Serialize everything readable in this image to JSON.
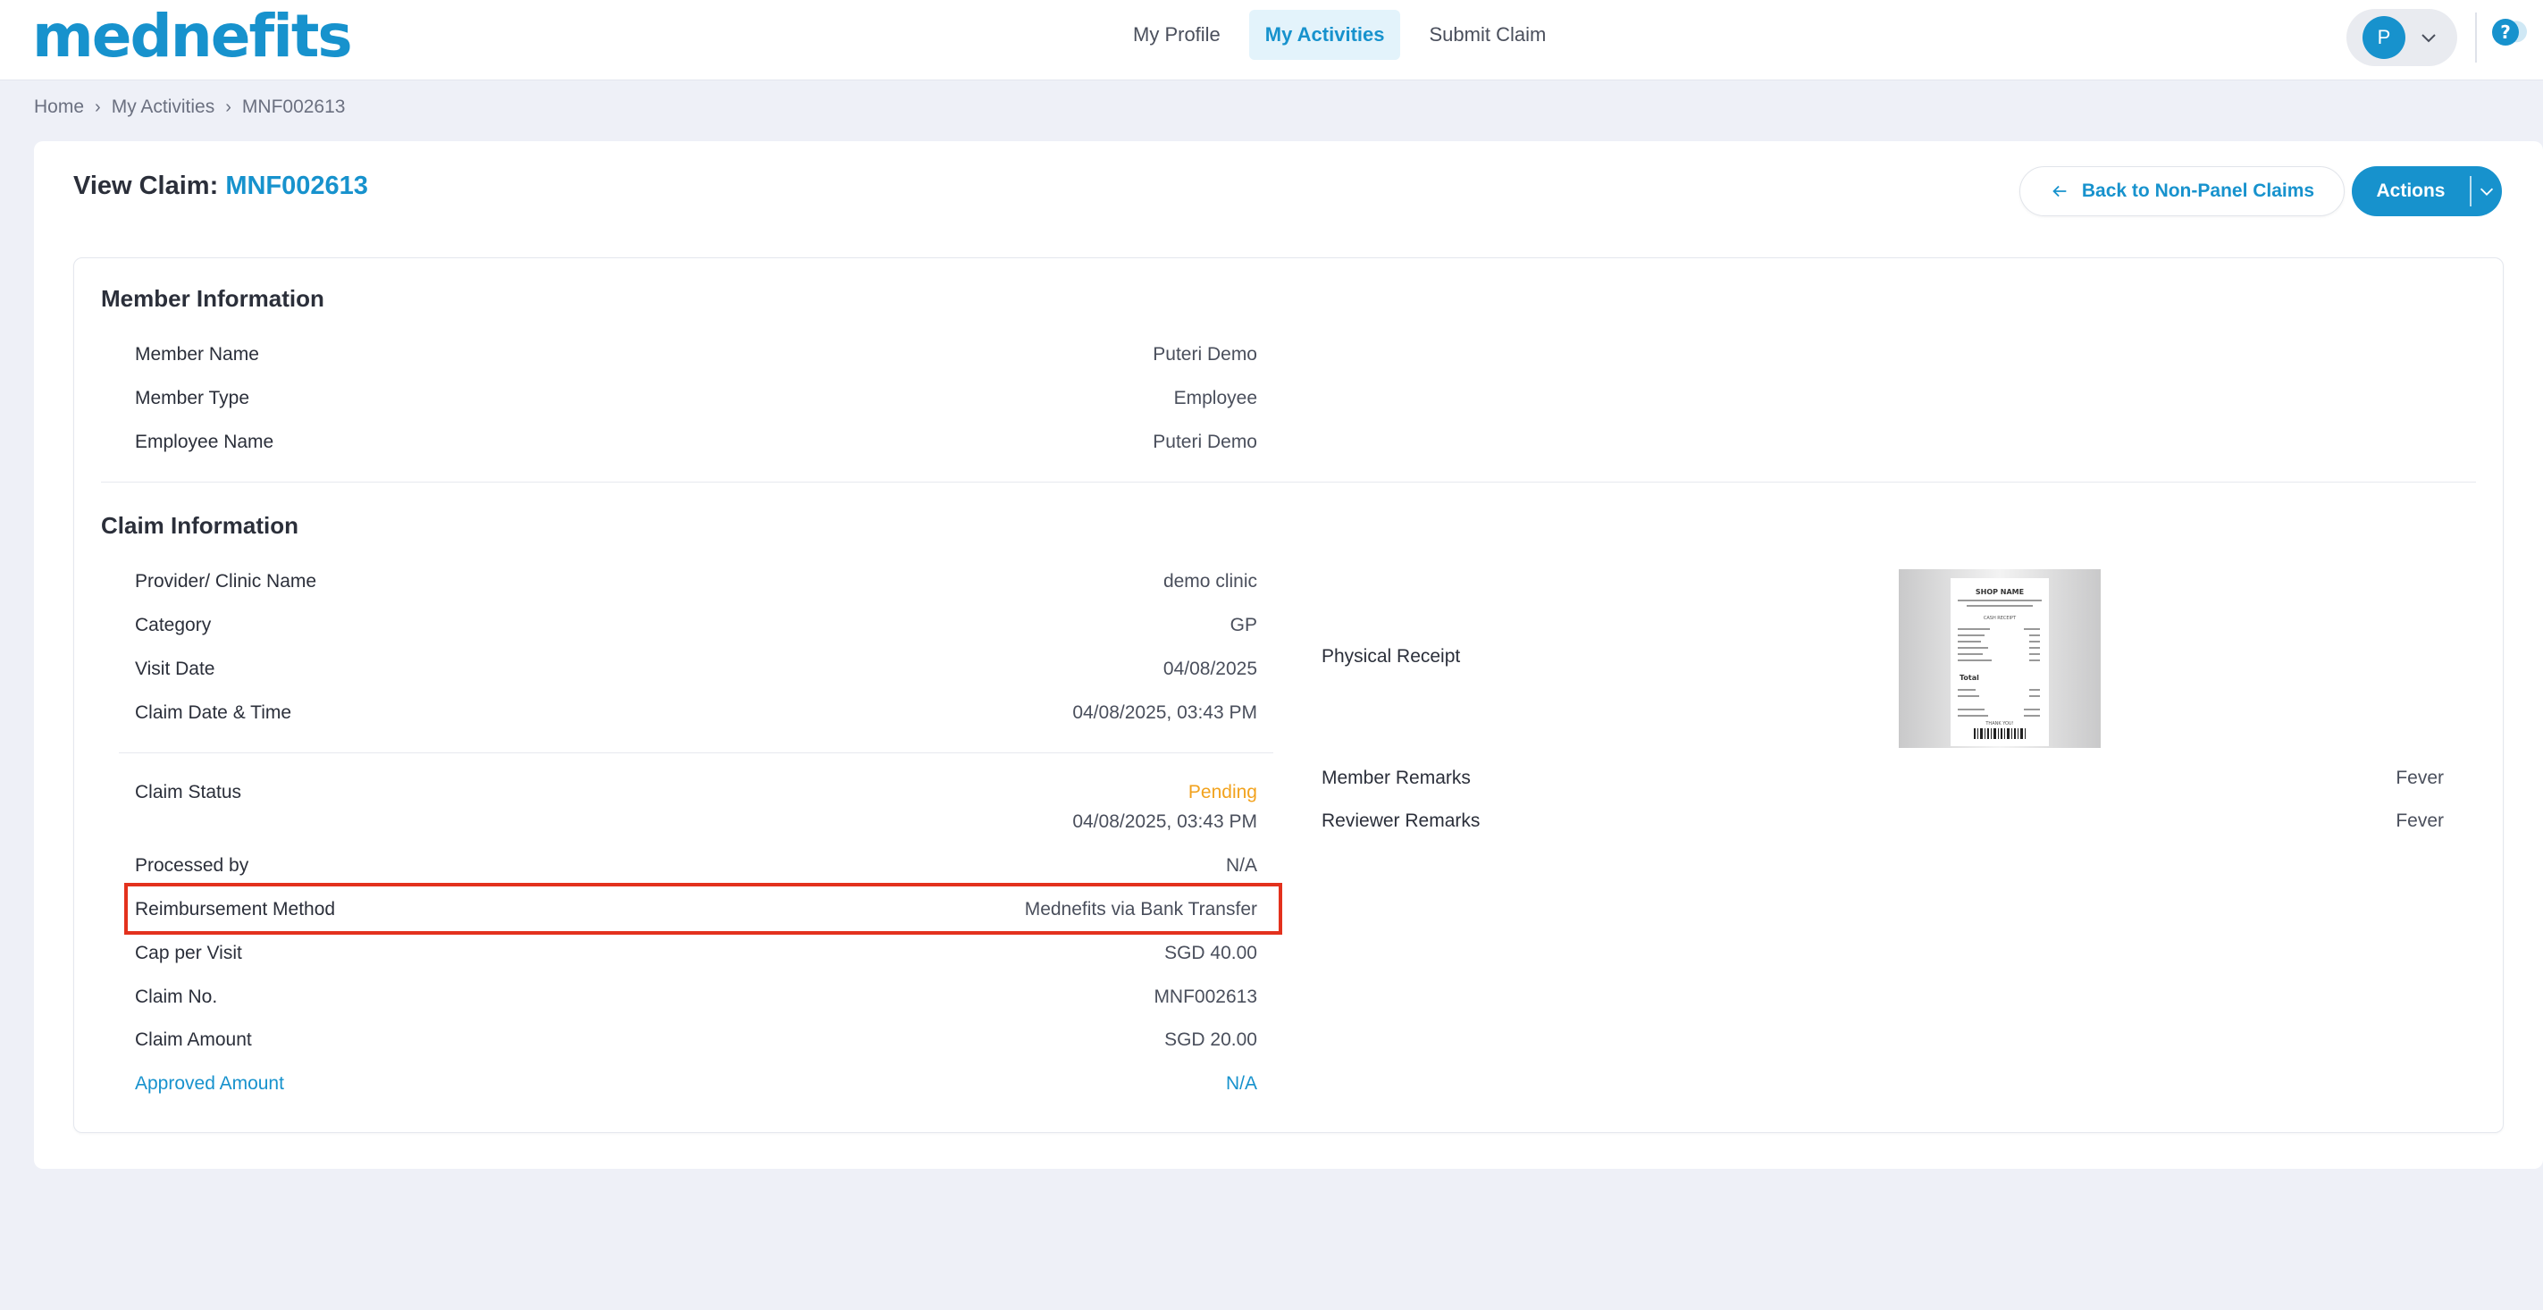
{
  "header": {
    "logo": "mednefits",
    "nav": [
      {
        "label": "My Profile",
        "active": false
      },
      {
        "label": "My Activities",
        "active": true
      },
      {
        "label": "Submit Claim",
        "active": false
      }
    ],
    "user_initial": "P",
    "help_icon": "?"
  },
  "breadcrumb": [
    "Home",
    "My Activities",
    "MNF002613"
  ],
  "page": {
    "title_prefix": "View Claim:",
    "claim_id": "MNF002613",
    "back_button": "Back to Non-Panel Claims",
    "actions_button": "Actions"
  },
  "member_info": {
    "title": "Member Information",
    "rows": [
      {
        "label": "Member Name",
        "value": "Puteri Demo"
      },
      {
        "label": "Member Type",
        "value": "Employee"
      },
      {
        "label": "Employee Name",
        "value": "Puteri Demo"
      }
    ]
  },
  "claim_info": {
    "title": "Claim Information",
    "rows_top": [
      {
        "label": "Provider/ Clinic Name",
        "value": "demo clinic"
      },
      {
        "label": "Category",
        "value": "GP"
      },
      {
        "label": "Visit Date",
        "value": "04/08/2025"
      },
      {
        "label": "Claim Date & Time",
        "value": "04/08/2025, 03:43 PM"
      }
    ],
    "status": {
      "label": "Claim Status",
      "value": "Pending",
      "timestamp": "04/08/2025, 03:43 PM"
    },
    "rows_bottom": [
      {
        "label": "Processed by",
        "value": "N/A"
      },
      {
        "label": "Reimbursement Method",
        "value": "Mednefits via Bank Transfer"
      },
      {
        "label": "Cap per Visit",
        "value": "SGD 40.00"
      },
      {
        "label": "Claim No.",
        "value": "MNF002613"
      },
      {
        "label": "Claim Amount",
        "value": "SGD 20.00"
      },
      {
        "label": "Approved Amount",
        "value": "N/A"
      }
    ],
    "right": {
      "receipt_label": "Physical Receipt",
      "receipt_image": {
        "shop_name": "SHOP NAME",
        "subtitle": "CASH RECEIPT",
        "total_label": "Total",
        "thanks": "THANK YOU!"
      },
      "member_remarks_label": "Member Remarks",
      "member_remarks": "Fever",
      "reviewer_remarks_label": "Reviewer Remarks",
      "reviewer_remarks": "Fever"
    }
  },
  "colors": {
    "brand": "#1792cd",
    "pending": "#f2a21d",
    "highlight": "#e3311d"
  }
}
